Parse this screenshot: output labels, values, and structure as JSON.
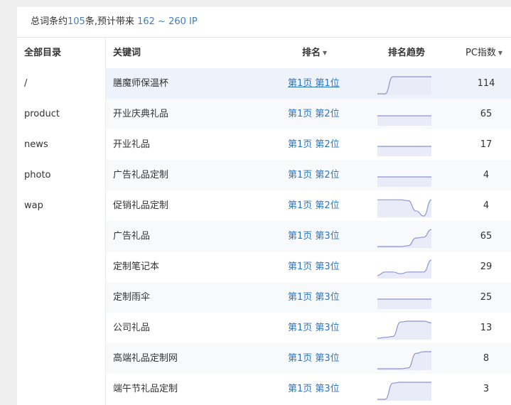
{
  "summary": {
    "prefix": "总词条约",
    "count": "105",
    "mid": "条,预计带来 ",
    "ip_range": "162 ~ 260 IP"
  },
  "sidebar": {
    "header": "全部目录",
    "items": [
      "/",
      "product",
      "news",
      "photo",
      "wap"
    ]
  },
  "table": {
    "headers": {
      "keyword": "关键词",
      "rank": "排名",
      "trend": "排名趋势",
      "pc_index": "PC指数"
    },
    "rows": [
      {
        "keyword": "膳魔师保温杯",
        "rank": "第1页 第1位",
        "pc": "114",
        "trend": [
          0,
          0,
          1,
          1,
          1,
          1,
          1,
          1
        ]
      },
      {
        "keyword": "开业庆典礼品",
        "rank": "第1页 第2位",
        "pc": "65",
        "trend": [
          0.5,
          0.5,
          0.5,
          0.5,
          0.5,
          0.5,
          0.5,
          0.5
        ]
      },
      {
        "keyword": "开业礼品",
        "rank": "第1页 第2位",
        "pc": "17",
        "trend": [
          0.5,
          0.5,
          0.5,
          0.5,
          0.5,
          0.5,
          0.5,
          0.5
        ]
      },
      {
        "keyword": "广告礼品定制",
        "rank": "第1页 第2位",
        "pc": "4",
        "trend": [
          0.5,
          0.5,
          0.5,
          0.5,
          0.5,
          0.5,
          0.5,
          0.5
        ]
      },
      {
        "keyword": "促销礼品定制",
        "rank": "第1页 第2位",
        "pc": "4",
        "trend": [
          0.95,
          0.95,
          0.95,
          0.95,
          0.9,
          0.3,
          0.0,
          0.95
        ]
      },
      {
        "keyword": "广告礼品",
        "rank": "第1页 第3位",
        "pc": "65",
        "trend": [
          0,
          0,
          0,
          0,
          0.05,
          0.5,
          0.55,
          1
        ]
      },
      {
        "keyword": "定制笔记本",
        "rank": "第1页 第3位",
        "pc": "29",
        "trend": [
          0.1,
          0.3,
          0.3,
          0.2,
          0.3,
          0.3,
          0.3,
          1
        ]
      },
      {
        "keyword": "定制雨伞",
        "rank": "第1页 第3位",
        "pc": "25",
        "trend": [
          0.5,
          0.5,
          0.5,
          0.5,
          0.5,
          0.5,
          0.5,
          0.5
        ]
      },
      {
        "keyword": "公司礼品",
        "rank": "第1页 第3位",
        "pc": "13",
        "trend": [
          0,
          0.05,
          0.1,
          0.95,
          1,
          1,
          1,
          0.9
        ]
      },
      {
        "keyword": "高端礼品定制网",
        "rank": "第1页 第3位",
        "pc": "8",
        "trend": [
          0,
          0,
          0,
          0,
          0.05,
          0.9,
          1,
          1
        ]
      },
      {
        "keyword": "端午节礼品定制",
        "rank": "第1页 第3位",
        "pc": "3",
        "trend": [
          0,
          0,
          0.95,
          1,
          1,
          1,
          1,
          1
        ]
      }
    ]
  },
  "colors": {
    "accent": "#2d74c4",
    "trend_line": "#8d93d0",
    "trend_fill": "#e9ecf8"
  }
}
